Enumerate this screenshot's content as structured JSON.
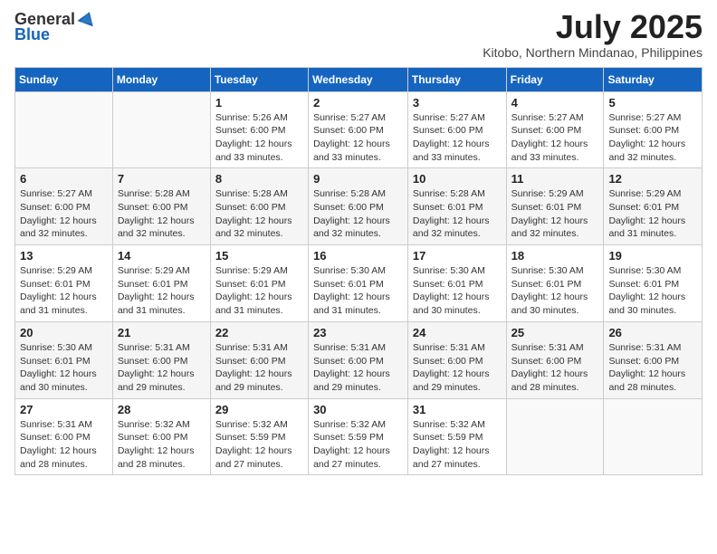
{
  "logo": {
    "general": "General",
    "blue": "Blue"
  },
  "title": {
    "month_year": "July 2025",
    "location": "Kitobo, Northern Mindanao, Philippines"
  },
  "header_days": [
    "Sunday",
    "Monday",
    "Tuesday",
    "Wednesday",
    "Thursday",
    "Friday",
    "Saturday"
  ],
  "weeks": [
    [
      {
        "day": "",
        "sunrise": "",
        "sunset": "",
        "daylight": ""
      },
      {
        "day": "",
        "sunrise": "",
        "sunset": "",
        "daylight": ""
      },
      {
        "day": "1",
        "sunrise": "Sunrise: 5:26 AM",
        "sunset": "Sunset: 6:00 PM",
        "daylight": "Daylight: 12 hours and 33 minutes."
      },
      {
        "day": "2",
        "sunrise": "Sunrise: 5:27 AM",
        "sunset": "Sunset: 6:00 PM",
        "daylight": "Daylight: 12 hours and 33 minutes."
      },
      {
        "day": "3",
        "sunrise": "Sunrise: 5:27 AM",
        "sunset": "Sunset: 6:00 PM",
        "daylight": "Daylight: 12 hours and 33 minutes."
      },
      {
        "day": "4",
        "sunrise": "Sunrise: 5:27 AM",
        "sunset": "Sunset: 6:00 PM",
        "daylight": "Daylight: 12 hours and 33 minutes."
      },
      {
        "day": "5",
        "sunrise": "Sunrise: 5:27 AM",
        "sunset": "Sunset: 6:00 PM",
        "daylight": "Daylight: 12 hours and 32 minutes."
      }
    ],
    [
      {
        "day": "6",
        "sunrise": "Sunrise: 5:27 AM",
        "sunset": "Sunset: 6:00 PM",
        "daylight": "Daylight: 12 hours and 32 minutes."
      },
      {
        "day": "7",
        "sunrise": "Sunrise: 5:28 AM",
        "sunset": "Sunset: 6:00 PM",
        "daylight": "Daylight: 12 hours and 32 minutes."
      },
      {
        "day": "8",
        "sunrise": "Sunrise: 5:28 AM",
        "sunset": "Sunset: 6:00 PM",
        "daylight": "Daylight: 12 hours and 32 minutes."
      },
      {
        "day": "9",
        "sunrise": "Sunrise: 5:28 AM",
        "sunset": "Sunset: 6:00 PM",
        "daylight": "Daylight: 12 hours and 32 minutes."
      },
      {
        "day": "10",
        "sunrise": "Sunrise: 5:28 AM",
        "sunset": "Sunset: 6:01 PM",
        "daylight": "Daylight: 12 hours and 32 minutes."
      },
      {
        "day": "11",
        "sunrise": "Sunrise: 5:29 AM",
        "sunset": "Sunset: 6:01 PM",
        "daylight": "Daylight: 12 hours and 32 minutes."
      },
      {
        "day": "12",
        "sunrise": "Sunrise: 5:29 AM",
        "sunset": "Sunset: 6:01 PM",
        "daylight": "Daylight: 12 hours and 31 minutes."
      }
    ],
    [
      {
        "day": "13",
        "sunrise": "Sunrise: 5:29 AM",
        "sunset": "Sunset: 6:01 PM",
        "daylight": "Daylight: 12 hours and 31 minutes."
      },
      {
        "day": "14",
        "sunrise": "Sunrise: 5:29 AM",
        "sunset": "Sunset: 6:01 PM",
        "daylight": "Daylight: 12 hours and 31 minutes."
      },
      {
        "day": "15",
        "sunrise": "Sunrise: 5:29 AM",
        "sunset": "Sunset: 6:01 PM",
        "daylight": "Daylight: 12 hours and 31 minutes."
      },
      {
        "day": "16",
        "sunrise": "Sunrise: 5:30 AM",
        "sunset": "Sunset: 6:01 PM",
        "daylight": "Daylight: 12 hours and 31 minutes."
      },
      {
        "day": "17",
        "sunrise": "Sunrise: 5:30 AM",
        "sunset": "Sunset: 6:01 PM",
        "daylight": "Daylight: 12 hours and 30 minutes."
      },
      {
        "day": "18",
        "sunrise": "Sunrise: 5:30 AM",
        "sunset": "Sunset: 6:01 PM",
        "daylight": "Daylight: 12 hours and 30 minutes."
      },
      {
        "day": "19",
        "sunrise": "Sunrise: 5:30 AM",
        "sunset": "Sunset: 6:01 PM",
        "daylight": "Daylight: 12 hours and 30 minutes."
      }
    ],
    [
      {
        "day": "20",
        "sunrise": "Sunrise: 5:30 AM",
        "sunset": "Sunset: 6:01 PM",
        "daylight": "Daylight: 12 hours and 30 minutes."
      },
      {
        "day": "21",
        "sunrise": "Sunrise: 5:31 AM",
        "sunset": "Sunset: 6:00 PM",
        "daylight": "Daylight: 12 hours and 29 minutes."
      },
      {
        "day": "22",
        "sunrise": "Sunrise: 5:31 AM",
        "sunset": "Sunset: 6:00 PM",
        "daylight": "Daylight: 12 hours and 29 minutes."
      },
      {
        "day": "23",
        "sunrise": "Sunrise: 5:31 AM",
        "sunset": "Sunset: 6:00 PM",
        "daylight": "Daylight: 12 hours and 29 minutes."
      },
      {
        "day": "24",
        "sunrise": "Sunrise: 5:31 AM",
        "sunset": "Sunset: 6:00 PM",
        "daylight": "Daylight: 12 hours and 29 minutes."
      },
      {
        "day": "25",
        "sunrise": "Sunrise: 5:31 AM",
        "sunset": "Sunset: 6:00 PM",
        "daylight": "Daylight: 12 hours and 28 minutes."
      },
      {
        "day": "26",
        "sunrise": "Sunrise: 5:31 AM",
        "sunset": "Sunset: 6:00 PM",
        "daylight": "Daylight: 12 hours and 28 minutes."
      }
    ],
    [
      {
        "day": "27",
        "sunrise": "Sunrise: 5:31 AM",
        "sunset": "Sunset: 6:00 PM",
        "daylight": "Daylight: 12 hours and 28 minutes."
      },
      {
        "day": "28",
        "sunrise": "Sunrise: 5:32 AM",
        "sunset": "Sunset: 6:00 PM",
        "daylight": "Daylight: 12 hours and 28 minutes."
      },
      {
        "day": "29",
        "sunrise": "Sunrise: 5:32 AM",
        "sunset": "Sunset: 5:59 PM",
        "daylight": "Daylight: 12 hours and 27 minutes."
      },
      {
        "day": "30",
        "sunrise": "Sunrise: 5:32 AM",
        "sunset": "Sunset: 5:59 PM",
        "daylight": "Daylight: 12 hours and 27 minutes."
      },
      {
        "day": "31",
        "sunrise": "Sunrise: 5:32 AM",
        "sunset": "Sunset: 5:59 PM",
        "daylight": "Daylight: 12 hours and 27 minutes."
      },
      {
        "day": "",
        "sunrise": "",
        "sunset": "",
        "daylight": ""
      },
      {
        "day": "",
        "sunrise": "",
        "sunset": "",
        "daylight": ""
      }
    ]
  ]
}
